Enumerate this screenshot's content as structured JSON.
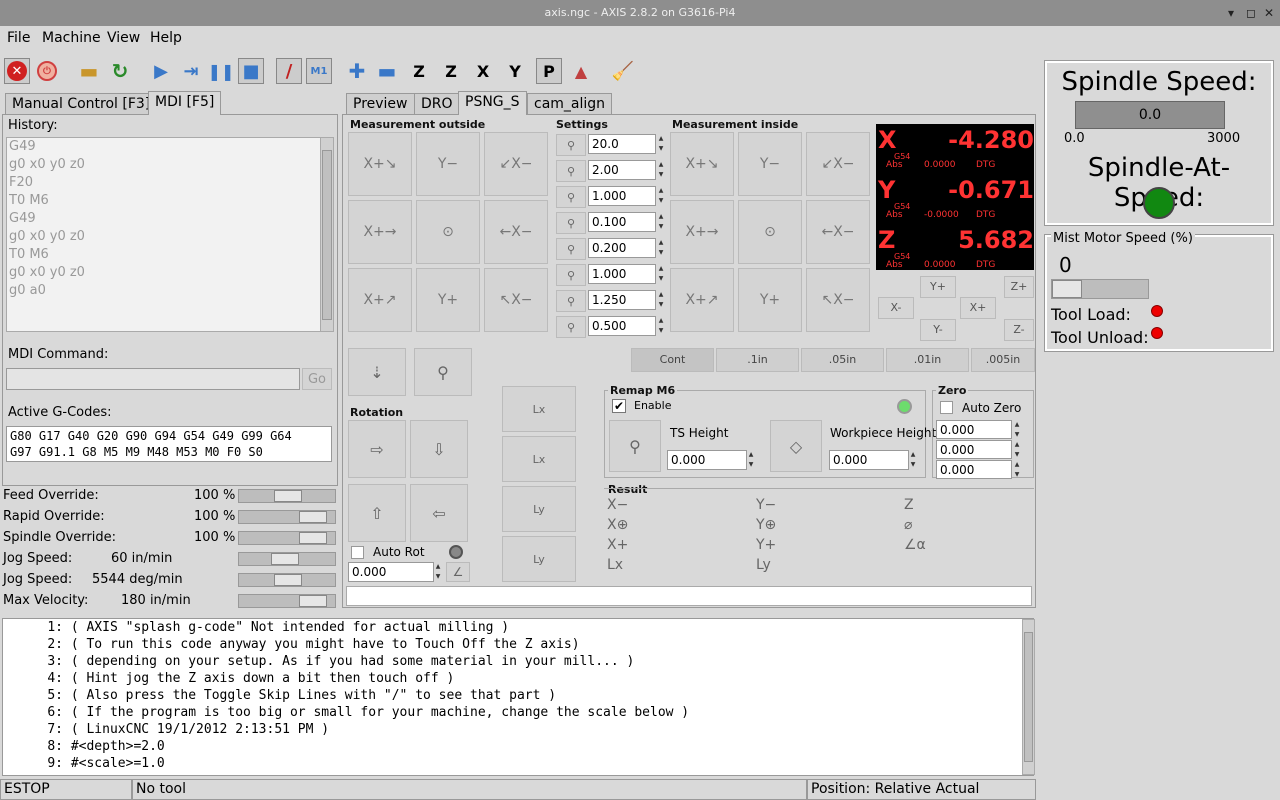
{
  "window": {
    "title": "axis.ngc - AXIS 2.8.2 on G3616-Pi4"
  },
  "menu": [
    "File",
    "Machine",
    "View",
    "Help"
  ],
  "tabs_left": {
    "manual": "Manual Control [F3]",
    "mdi": "MDI [F5]"
  },
  "tabs_right": [
    "Preview",
    "DRO",
    "PSNG_S",
    "cam_align"
  ],
  "mdi": {
    "history_label": "History:",
    "history": [
      "G49",
      "g0 x0 y0 z0",
      "F20",
      "T0 M6",
      "G49",
      "g0 x0 y0 z0",
      "T0 M6",
      "g0 x0 y0 z0",
      "g0 a0"
    ],
    "command_label": "MDI Command:",
    "go": "Go",
    "active_label": "Active G-Codes:",
    "active_line1": "G80 G17 G40 G20 G90 G94 G54 G49 G99 G64",
    "active_line2": "G97 G91.1 G8 M5 M9 M48 M53 M0 F0 S0"
  },
  "overrides": [
    {
      "label": "Feed Override:",
      "value": "100 %",
      "pct": 0.5
    },
    {
      "label": "Rapid Override:",
      "value": "100 %",
      "pct": 0.85
    },
    {
      "label": "Spindle Override:",
      "value": "100 %",
      "pct": 0.85
    },
    {
      "label": "Jog Speed:",
      "value": "60 in/min",
      "pct": 0.45
    },
    {
      "label": "Jog Speed:",
      "value": "5544 deg/min",
      "pct": 0.5
    },
    {
      "label": "Max Velocity:",
      "value": "180 in/min",
      "pct": 0.85
    }
  ],
  "psng": {
    "meas_outside": "Measurement outside",
    "settings": "Settings",
    "meas_inside": "Measurement inside",
    "settings_values": [
      "20.0",
      "2.00",
      "1.000",
      "0.100",
      "0.200",
      "1.000",
      "1.250",
      "0.500"
    ],
    "rotation": "Rotation",
    "auto_rot": "Auto Rot",
    "rot_value": "0.000",
    "remap": "Remap M6",
    "enable": "Enable",
    "ts_height": "TS Height",
    "ts_value": "0.000",
    "wp_height": "Workpiece Height",
    "wp_value": "0.000",
    "zero": "Zero",
    "auto_zero": "Auto Zero",
    "zero_values": [
      "0.000",
      "0.000",
      "0.000"
    ],
    "result": "Result",
    "increments": [
      "Cont",
      ".1in",
      ".05in",
      ".01in",
      ".005in"
    ],
    "jog": {
      "yp": "Y+",
      "ym": "Y-",
      "xm": "X-",
      "xp": "X+",
      "zp": "Z+",
      "zm": "Z-"
    }
  },
  "dro": [
    {
      "axis": "X",
      "g54": "G54",
      "value": "-4.280",
      "abs": "0.0000",
      "dtg": "DTG",
      "abs_label": "Abs"
    },
    {
      "axis": "Y",
      "g54": "G54",
      "value": "-0.671",
      "abs": "-0.0000",
      "dtg": "DTG",
      "abs_label": "Abs"
    },
    {
      "axis": "Z",
      "g54": "G54",
      "value": "5.682",
      "abs": "0.0000",
      "dtg": "DTG",
      "abs_label": "Abs"
    }
  ],
  "spindle": {
    "title": "Spindle Speed:",
    "value": "0.0",
    "min": "0.0",
    "max": "3000",
    "at_speed": "Spindle-At-Speed:"
  },
  "mist": {
    "title": "Mist Motor Speed (%)",
    "value": "0",
    "tool_load": "Tool Load:",
    "tool_unload": "Tool Unload:"
  },
  "gcode": [
    {
      "n": "1:",
      "t": "( AXIS \"splash g-code\" Not intended for actual milling )"
    },
    {
      "n": "2:",
      "t": "( To run this code anyway you might have to Touch Off the Z axis)"
    },
    {
      "n": "3:",
      "t": "( depending on your setup. As if you had some material in your mill... )"
    },
    {
      "n": "4:",
      "t": "( Hint jog the Z axis down a bit then touch off )"
    },
    {
      "n": "5:",
      "t": "( Also press the Toggle Skip Lines with \"/\" to see that part )"
    },
    {
      "n": "6:",
      "t": "( If the program is too big or small for your machine, change the scale below )"
    },
    {
      "n": "7:",
      "t": "( LinuxCNC 19/1/2012 2:13:51 PM )"
    },
    {
      "n": "8:",
      "t": "#<depth>=2.0"
    },
    {
      "n": "9:",
      "t": "#<scale>=1.0"
    }
  ],
  "status": {
    "estop": "ESTOP",
    "tool": "No tool",
    "position": "Position: Relative Actual"
  },
  "colors": {
    "estop_red": "#d02020",
    "dro_red": "#ff3030",
    "led_green": "#118811",
    "led_red": "#ee0000"
  }
}
